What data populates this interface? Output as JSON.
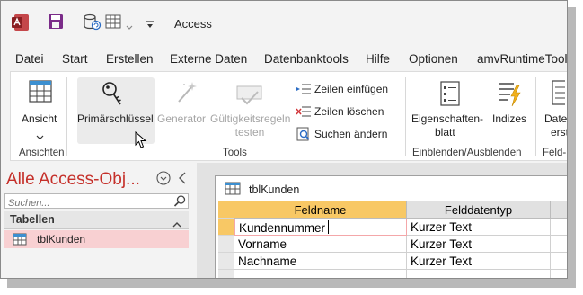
{
  "titlebar": {
    "app_title": "Access",
    "icons": [
      "access-logo-icon",
      "save-icon",
      "refresh-database-icon",
      "table-view-icon",
      "chevron-down-icon",
      "customize-quick-access-icon"
    ]
  },
  "menu": {
    "items": [
      "Datei",
      "Start",
      "Erstellen",
      "Externe Daten",
      "Datenbanktools",
      "Hilfe",
      "Optionen",
      "amvRuntimeTools"
    ]
  },
  "ribbon": {
    "ansicht_label": "Ansicht",
    "ansicht_group": "Ansichten",
    "primaer_label": "Primärschlüssel",
    "generator_label": "Generator",
    "gueltig_line1": "Gültigkeitsregeln",
    "gueltig_line2": "testen",
    "zeilen_einfuegen": "Zeilen einfügen",
    "zeilen_loeschen": "Zeilen löschen",
    "suchen_aendern": "Suchen ändern",
    "tools_group": "Tools",
    "eigenschaften_line1": "Eigenschaften-",
    "eigenschaften_line2": "blatt",
    "indizes_label": "Indizes",
    "einblenden_group": "Einblenden/Ausblenden",
    "datei_line1": "Date",
    "datei_line2": "erst",
    "feld_group": "Feld-, D"
  },
  "nav": {
    "title": "Alle Access-Obj...",
    "search_placeholder": "Suchen...",
    "section": "Tabellen",
    "items": [
      {
        "label": "tblKunden"
      }
    ]
  },
  "document": {
    "tab_label": "tblKunden",
    "columns": [
      "Feldname",
      "Felddatentyp"
    ],
    "rows": [
      {
        "feldname": "Kundennummer",
        "typ": "Kurzer Text"
      },
      {
        "feldname": "Vorname",
        "typ": "Kurzer Text"
      },
      {
        "feldname": "Nachname",
        "typ": "Kurzer Text"
      }
    ]
  },
  "colors": {
    "access_red": "#a4373a",
    "nav_title": "#c5302a",
    "selected_header": "#f8c865",
    "nav_selected": "#f8d0d2"
  }
}
